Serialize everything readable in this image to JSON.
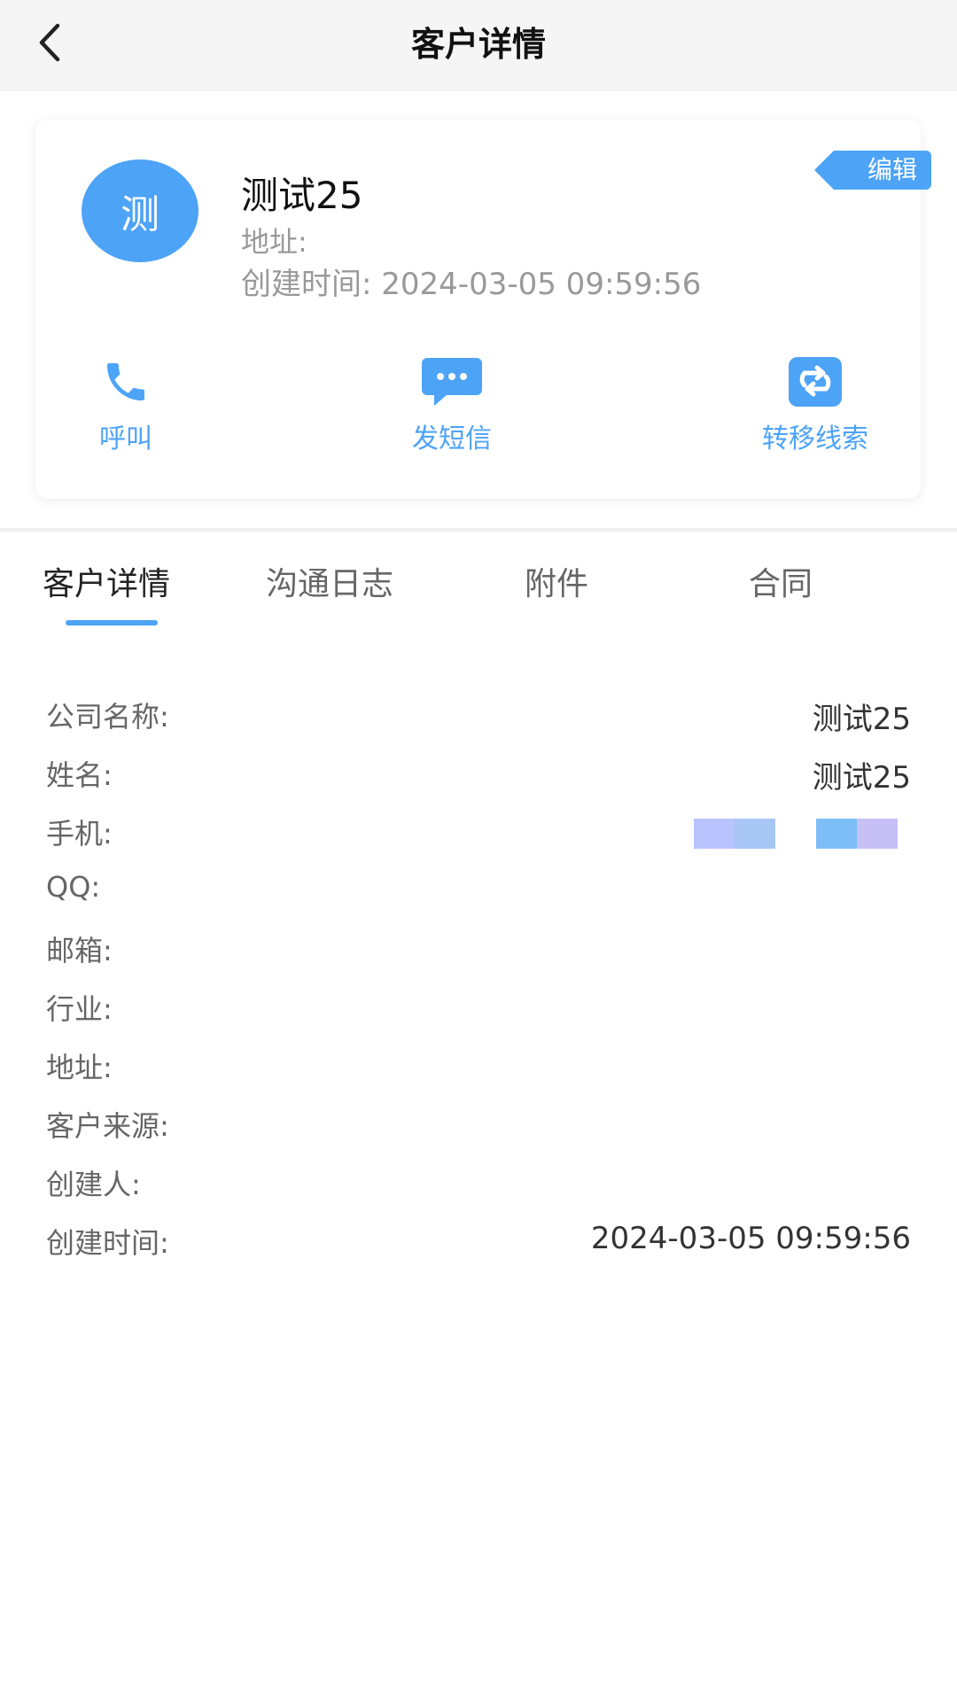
{
  "nav": {
    "title": "客户详情"
  },
  "profile": {
    "avatar_char": "测",
    "name": "测试25",
    "address_label": "地址:",
    "created_label": "创建时间:",
    "created_value": "2024-03-05 09:59:56",
    "edit_label": "编辑"
  },
  "actions": [
    {
      "label": "呼叫",
      "icon": "phone-icon"
    },
    {
      "label": "发短信",
      "icon": "chat-bubble-icon"
    },
    {
      "label": "转移线索",
      "icon": "transfer-icon"
    }
  ],
  "tabs": [
    {
      "label": "客户详情",
      "active": true
    },
    {
      "label": "沟通日志",
      "active": false
    },
    {
      "label": "附件",
      "active": false
    },
    {
      "label": "合同",
      "active": false
    }
  ],
  "details": [
    {
      "key": "公司名称:",
      "value": "测试25"
    },
    {
      "key": "姓名:",
      "value": "测试25"
    },
    {
      "key": "手机:",
      "value": ""
    },
    {
      "key": "QQ:",
      "value": ""
    },
    {
      "key": "邮箱:",
      "value": ""
    },
    {
      "key": "行业:",
      "value": ""
    },
    {
      "key": "地址:",
      "value": ""
    },
    {
      "key": "客户来源:",
      "value": ""
    },
    {
      "key": "创建人:",
      "value": ""
    },
    {
      "key": "创建时间:",
      "value": "2024-03-05 09:59:56"
    }
  ],
  "colors": {
    "accent": "#4da3f6",
    "nav_bg": "#f5f5f5",
    "muted": "#999999"
  }
}
